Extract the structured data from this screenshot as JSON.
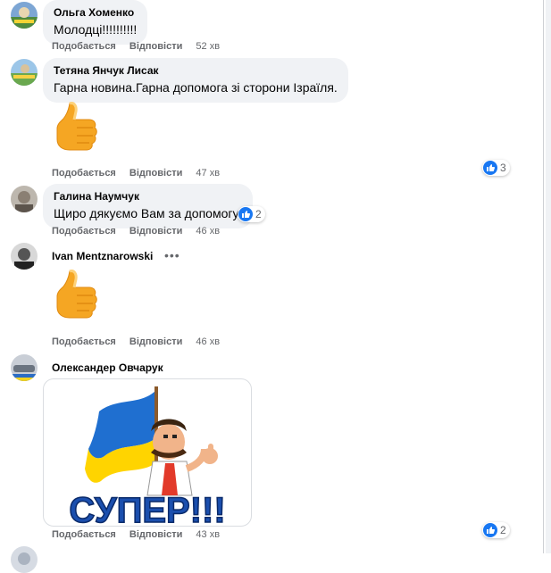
{
  "comments": [
    {
      "author": "Ольга Хоменко",
      "text": "Молодці!!!!!!!!!!",
      "like_label": "Подобається",
      "reply_label": "Відповісти",
      "time": "52 хв"
    },
    {
      "author": "Тетяна Янчук Лисак",
      "text": "Гарна новина.Гарна допомога зі сторони Ізраїля.",
      "like_label": "Подобається",
      "reply_label": "Відповісти",
      "time": "47 хв",
      "reactions": "3"
    },
    {
      "author": "Галина Наумчук",
      "text": "Щиро дякуємо Вам за допомогу!",
      "like_label": "Подобається",
      "reply_label": "Відповісти",
      "time": "46 хв",
      "reactions": "2"
    },
    {
      "author": "Ivan Mentznarowski",
      "more": "•••",
      "like_label": "Подобається",
      "reply_label": "Відповісти",
      "time": "46 хв"
    },
    {
      "author": "Олександер Овчарук",
      "sticker_text": "СУПЕР!!!",
      "like_label": "Подобається",
      "reply_label": "Відповісти",
      "time": "43 хв",
      "reactions": "2"
    }
  ],
  "colors": {
    "like_blue": "#1877f2",
    "bubble": "#f0f2f5",
    "meta_gray": "#65676b"
  }
}
